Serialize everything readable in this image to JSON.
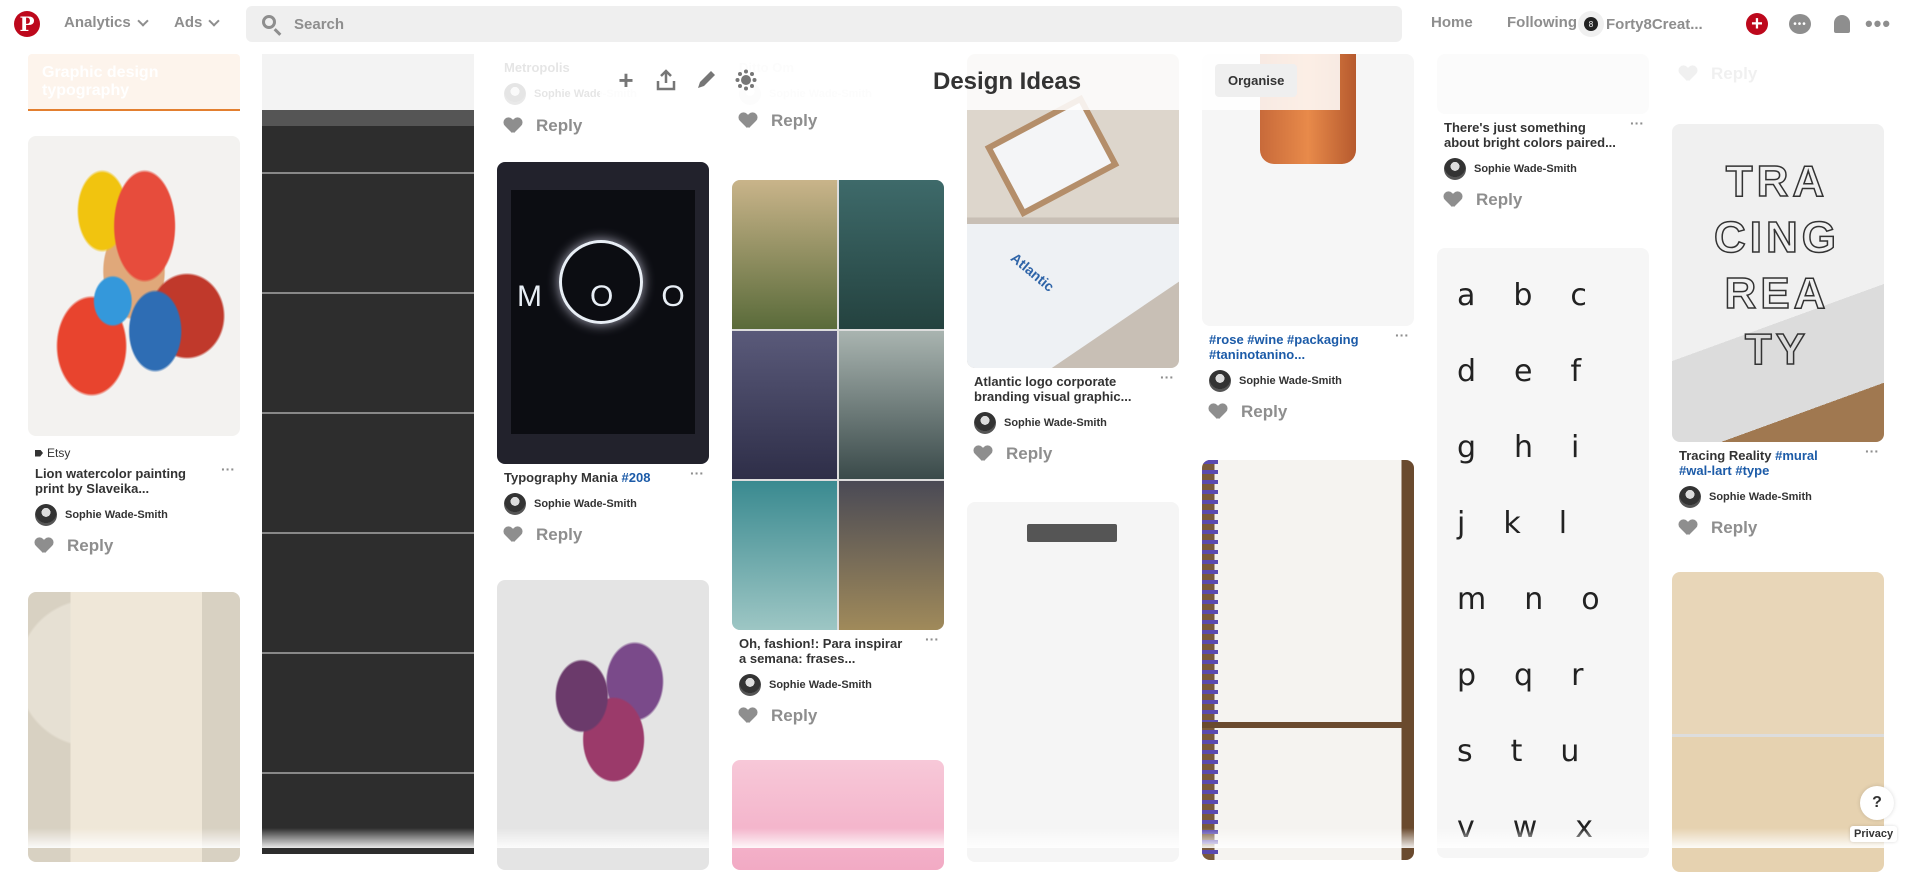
{
  "topbar": {
    "logo": "P",
    "analytics_label": "Analytics",
    "ads_label": "Ads",
    "search_placeholder": "Search",
    "home_label": "Home",
    "following_label": "Following",
    "account_badge": "8",
    "account_name": "Forty8Creat...",
    "more_label": "•••"
  },
  "board": {
    "title": "Design Ideas",
    "organise_label": "Organise",
    "tools": [
      "add-icon",
      "share-icon",
      "edit-icon",
      "more-ideas-icon"
    ]
  },
  "pins": {
    "section_header": "Graphic design typography",
    "lion": {
      "source": "Etsy",
      "title": "Lion watercolor painting print by Slaveika...",
      "user": "Sophie Wade-Smith",
      "reply": "Reply"
    },
    "metropolis": {
      "title": "Metropolis",
      "user": "Sophie Wade-Smith",
      "reply": "Reply"
    },
    "moon": {
      "title": "Typography Mania ",
      "hashtag": "#208",
      "user": "Sophie Wade-Smith",
      "reply": "Reply",
      "image_text": "MOON"
    },
    "ditto": {
      "title": "Ditto Om",
      "user": "Sophie Wade-Smith",
      "reply": "Reply"
    },
    "fashion": {
      "title": "Oh, fashion!: Para inspirar a semana: frases...",
      "user": "Sophie Wade-Smith",
      "reply": "Reply"
    },
    "atlantic": {
      "title": "Atlantic logo corporate branding visual graphic...",
      "user": "Sophie Wade-Smith",
      "reply": "Reply",
      "image_text": "Atlantic"
    },
    "rose": {
      "title": "#rose #wine #packaging #taninotanino...",
      "user": "Sophie Wade-Smith",
      "reply": "Reply"
    },
    "bright": {
      "title": "There's just something about bright colors paired...",
      "user": "Sophie Wade-Smith",
      "reply": "Reply"
    },
    "tracing": {
      "title": "Tracing Reality ",
      "hashtag": "#mural #wal-lart #type",
      "user": "Sophie Wade-Smith",
      "reply": "Reply"
    },
    "topright": {
      "reply": "Reply"
    }
  },
  "footer": {
    "help": "?",
    "privacy": "Privacy"
  }
}
